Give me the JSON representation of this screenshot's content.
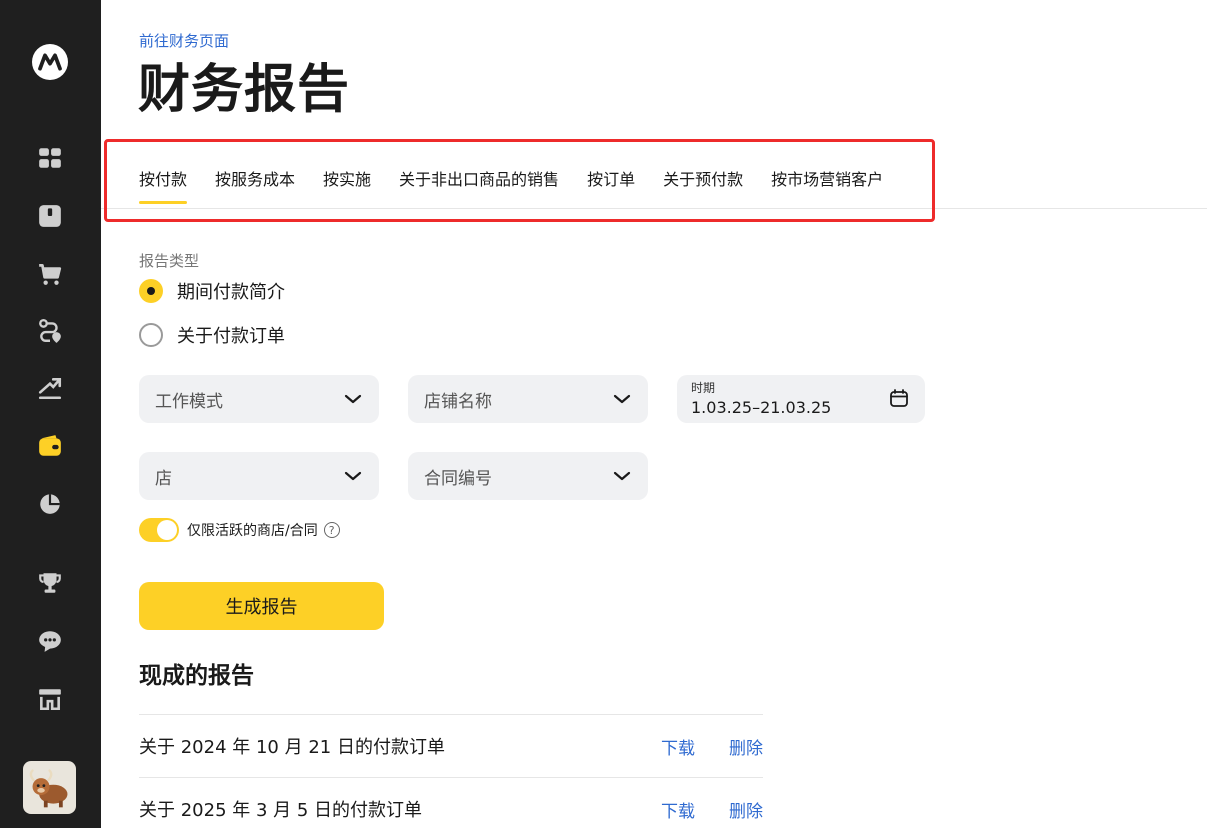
{
  "sidebar": {
    "logo": "market-logo",
    "items": [
      {
        "icon": "dashboard-icon"
      },
      {
        "icon": "box-icon"
      },
      {
        "icon": "cart-icon"
      },
      {
        "icon": "route-icon"
      },
      {
        "icon": "trend-icon"
      },
      {
        "icon": "wallet-icon",
        "active": true
      },
      {
        "icon": "pie-chart-icon"
      },
      {
        "icon": "trophy-icon"
      },
      {
        "icon": "chat-icon"
      },
      {
        "icon": "store-icon"
      }
    ],
    "avatar": "yak-avatar"
  },
  "header": {
    "back_link": "前往财务页面",
    "title": "财务报告"
  },
  "tabs": [
    {
      "label": "按付款",
      "active": true
    },
    {
      "label": "按服务成本"
    },
    {
      "label": "按实施"
    },
    {
      "label": "关于非出口商品的销售"
    },
    {
      "label": "按订单"
    },
    {
      "label": "关于预付款"
    },
    {
      "label": "按市场营销客户"
    }
  ],
  "report_type": {
    "label": "报告类型",
    "options": [
      {
        "label": "期间付款简介",
        "checked": true
      },
      {
        "label": "关于付款订单",
        "checked": false
      }
    ]
  },
  "filters": {
    "work_mode": "工作模式",
    "store_name": "店铺名称",
    "period_label": "时期",
    "period_value": "1.03.25–21.03.25",
    "store": "店",
    "contract_number": "合同编号"
  },
  "toggle": {
    "label": "仅限活跃的商店/合同",
    "on": true,
    "help": "?"
  },
  "generate_button": "生成报告",
  "reports": {
    "title": "现成的报告",
    "items": [
      {
        "name": "关于 2024 年 10 月 21 日的付款订单",
        "download": "下载",
        "delete": "删除"
      },
      {
        "name": "关于 2025 年 3 月 5 日的付款订单",
        "download": "下载",
        "delete": "删除"
      }
    ]
  },
  "colors": {
    "accent": "#fdd026",
    "sidebar_bg": "#1f1f1f",
    "link": "#2f6ad0",
    "highlight": "#ee2b2b"
  }
}
